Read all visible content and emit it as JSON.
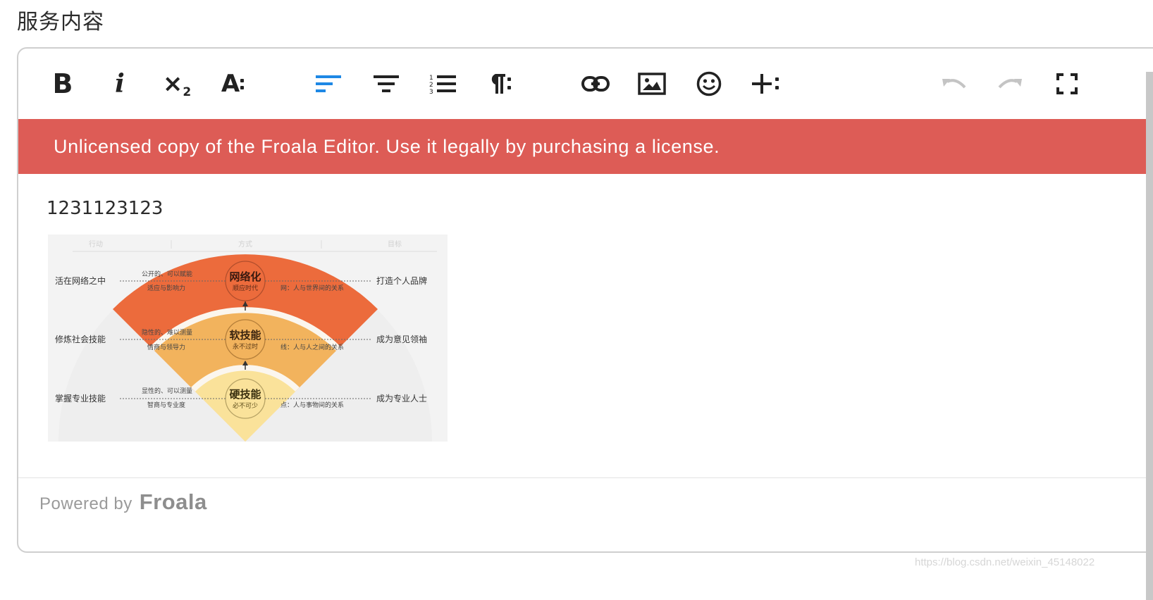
{
  "page": {
    "title": "服务内容"
  },
  "toolbar": {
    "bold_label": "B",
    "italic_label": "i",
    "subscript_label": "×",
    "subscript_index": "2",
    "font_size_label": "A",
    "icons": {
      "bold": "bold-icon",
      "italic": "italic-icon",
      "subscript": "subscript-icon",
      "text_format_more": "text-format-more-icon",
      "align_left": "align-left-icon",
      "align_center": "align-center-icon",
      "ordered_list": "ordered-list-icon",
      "paragraph_more": "paragraph-more-icon",
      "link": "link-icon",
      "image": "image-icon",
      "emoticons": "emoticon-icon",
      "insert_more": "insert-more-icon",
      "undo": "undo-icon",
      "redo": "redo-icon",
      "fullscreen": "fullscreen-icon"
    },
    "active_color": "#1e88e5",
    "disabled_color": "#c4c4c4"
  },
  "banner": {
    "text": "Unlicensed copy of the Froala Editor. Use it legally by purchasing a license.",
    "background": "#dd5c56"
  },
  "content": {
    "text": "1231123123",
    "image": {
      "headers": [
        "行动",
        "方式",
        "目标"
      ],
      "left_labels": [
        "活在网络之中",
        "修炼社会技能",
        "掌握专业技能"
      ],
      "right_labels": [
        "打造个人品牌",
        "成为意见领袖",
        "成为专业人士"
      ],
      "circles": [
        {
          "title": "网络化",
          "subtitle": "顺应时代"
        },
        {
          "title": "软技能",
          "subtitle": "永不过时"
        },
        {
          "title": "硬技能",
          "subtitle": "必不可少"
        }
      ],
      "left_notes": [
        [
          "公开的、可以赋能",
          "适应与影响力"
        ],
        [
          "隐性的、难以测量",
          "情商与领导力"
        ],
        [
          "显性的、可以测量",
          "智商与专业度"
        ]
      ],
      "right_notes": [
        "网：人与世界间的关系",
        "线：人与人之间的关系",
        "点：人与事物间的关系"
      ],
      "band_colors": [
        "#ec6b3c",
        "#f2b35d",
        "#fae29a"
      ]
    }
  },
  "footer": {
    "powered_by": "Powered by",
    "brand": "Froala"
  },
  "watermark": "https://blog.csdn.net/weixin_45148022"
}
